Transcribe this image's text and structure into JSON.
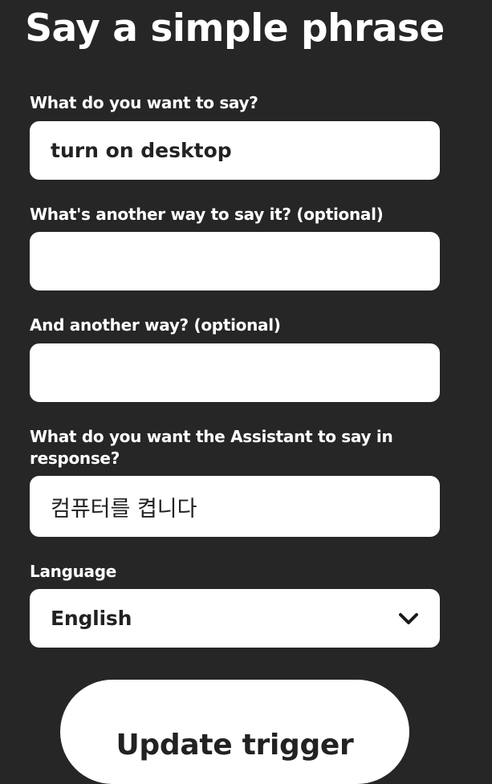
{
  "page": {
    "title": "Say a simple phrase"
  },
  "form": {
    "phrase": {
      "label": "What do you want to say?",
      "value": "turn on desktop",
      "placeholder": ""
    },
    "alt_phrase_1": {
      "label": "What's another way to say it? (optional)",
      "value": "",
      "placeholder": ""
    },
    "alt_phrase_2": {
      "label": "And another way? (optional)",
      "value": "",
      "placeholder": ""
    },
    "response": {
      "label": "What do you want the Assistant to say in response?",
      "value": "컴퓨터를 켭니다",
      "placeholder": ""
    },
    "language": {
      "label": "Language",
      "selected": "English",
      "icon": "chevron-down-icon"
    },
    "submit_label": "Update trigger"
  },
  "colors": {
    "background": "#262626",
    "field_background": "#ffffff",
    "field_text": "#222222",
    "label_text": "#ffffff"
  }
}
